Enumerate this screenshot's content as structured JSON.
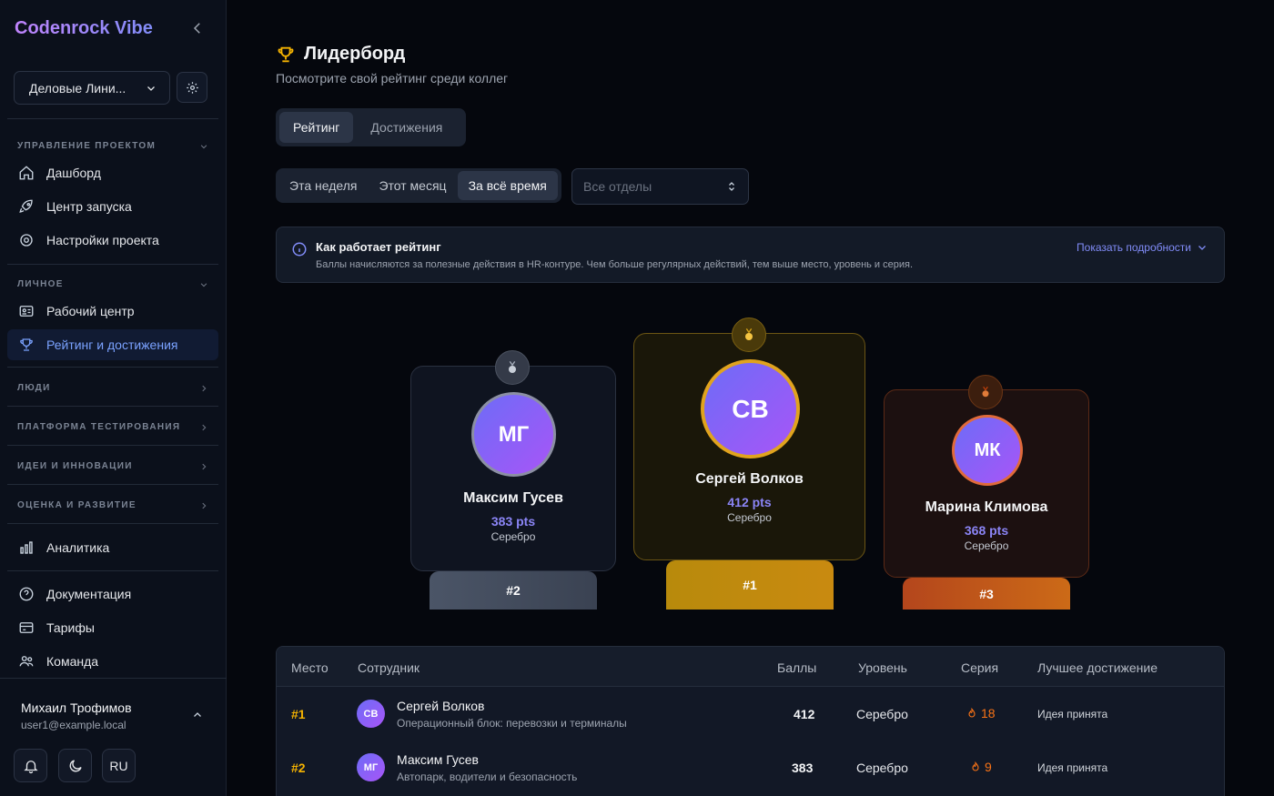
{
  "brand": "Codenrock Vibe",
  "org": {
    "name": "Деловые Лини..."
  },
  "sidebar": {
    "sections": [
      {
        "label": "УПРАВЛЕНИЕ ПРОЕКТОМ",
        "items": [
          "Дашборд",
          "Центр запуска",
          "Настройки проекта"
        ]
      },
      {
        "label": "ЛИЧНОЕ",
        "items": [
          "Рабочий центр",
          "Рейтинг и достижения"
        ]
      },
      {
        "label": "ЛЮДИ"
      },
      {
        "label": "ПЛАТФОРМА ТЕСТИРОВАНИЯ"
      },
      {
        "label": "ИДЕИ И ИННОВАЦИИ"
      },
      {
        "label": "ОЦЕНКА И РАЗВИТИЕ"
      }
    ],
    "analytics": "Аналитика",
    "docs": "Документация",
    "tariffs": "Тарифы",
    "team": "Команда",
    "active_color": "#7aa2ff"
  },
  "user": {
    "name": "Михаил Трофимов",
    "email": "user1@example.local",
    "lang": "RU"
  },
  "header": {
    "title": "Лидерборд",
    "subtitle": "Посмотрите свой рейтинг среди коллег"
  },
  "tabs": [
    "Рейтинг",
    "Достижения"
  ],
  "periods": [
    "Эта неделя",
    "Этот месяц",
    "За всё время"
  ],
  "dept": {
    "placeholder": "Все отделы"
  },
  "info": {
    "title": "Как работает рейтинг",
    "text": "Баллы начисляются за полезные действия в HR-контуре. Чем больше регулярных действий, тем выше место, уровень и серия.",
    "more": "Показать подробности"
  },
  "podium": [
    {
      "place": "#2",
      "initials": "МГ",
      "name": "Максим Гусев",
      "pts": "383 pts",
      "level": "Серебро",
      "medal": "silver-medal-icon"
    },
    {
      "place": "#1",
      "initials": "СВ",
      "name": "Сергей Волков",
      "pts": "412 pts",
      "level": "Серебро",
      "medal": "gold-medal-icon"
    },
    {
      "place": "#3",
      "initials": "МК",
      "name": "Марина Климова",
      "pts": "368 pts",
      "level": "Серебро",
      "medal": "bronze-medal-icon"
    }
  ],
  "table": {
    "headers": [
      "Место",
      "Сотрудник",
      "Баллы",
      "Уровень",
      "Серия",
      "Лучшее достижение"
    ],
    "rows": [
      {
        "rank": "#1",
        "initials": "СВ",
        "name": "Сергей Волков",
        "dept": "Операционный блок: перевозки и терминалы",
        "points": "412",
        "level": "Серебро",
        "streak": "18",
        "best": "Идея принята"
      },
      {
        "rank": "#2",
        "initials": "МГ",
        "name": "Максим Гусев",
        "dept": "Автопарк, водители и безопасность",
        "points": "383",
        "level": "Серебро",
        "streak": "9",
        "best": "Идея принята"
      }
    ]
  }
}
